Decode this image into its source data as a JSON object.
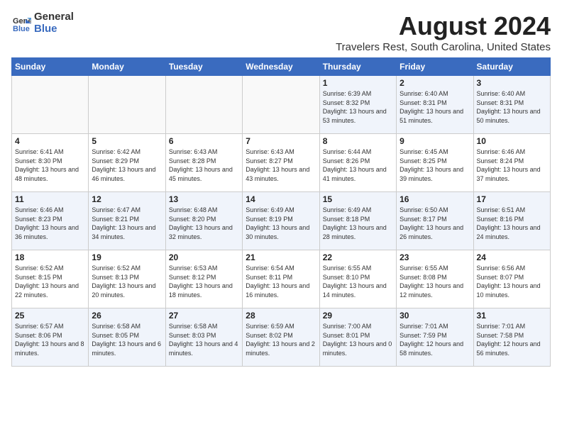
{
  "logo": {
    "general": "General",
    "blue": "Blue"
  },
  "title": "August 2024",
  "subtitle": "Travelers Rest, South Carolina, United States",
  "days_of_week": [
    "Sunday",
    "Monday",
    "Tuesday",
    "Wednesday",
    "Thursday",
    "Friday",
    "Saturday"
  ],
  "weeks": [
    [
      {
        "day": "",
        "detail": ""
      },
      {
        "day": "",
        "detail": ""
      },
      {
        "day": "",
        "detail": ""
      },
      {
        "day": "",
        "detail": ""
      },
      {
        "day": "1",
        "detail": "Sunrise: 6:39 AM\nSunset: 8:32 PM\nDaylight: 13 hours\nand 53 minutes."
      },
      {
        "day": "2",
        "detail": "Sunrise: 6:40 AM\nSunset: 8:31 PM\nDaylight: 13 hours\nand 51 minutes."
      },
      {
        "day": "3",
        "detail": "Sunrise: 6:40 AM\nSunset: 8:31 PM\nDaylight: 13 hours\nand 50 minutes."
      }
    ],
    [
      {
        "day": "4",
        "detail": "Sunrise: 6:41 AM\nSunset: 8:30 PM\nDaylight: 13 hours\nand 48 minutes."
      },
      {
        "day": "5",
        "detail": "Sunrise: 6:42 AM\nSunset: 8:29 PM\nDaylight: 13 hours\nand 46 minutes."
      },
      {
        "day": "6",
        "detail": "Sunrise: 6:43 AM\nSunset: 8:28 PM\nDaylight: 13 hours\nand 45 minutes."
      },
      {
        "day": "7",
        "detail": "Sunrise: 6:43 AM\nSunset: 8:27 PM\nDaylight: 13 hours\nand 43 minutes."
      },
      {
        "day": "8",
        "detail": "Sunrise: 6:44 AM\nSunset: 8:26 PM\nDaylight: 13 hours\nand 41 minutes."
      },
      {
        "day": "9",
        "detail": "Sunrise: 6:45 AM\nSunset: 8:25 PM\nDaylight: 13 hours\nand 39 minutes."
      },
      {
        "day": "10",
        "detail": "Sunrise: 6:46 AM\nSunset: 8:24 PM\nDaylight: 13 hours\nand 37 minutes."
      }
    ],
    [
      {
        "day": "11",
        "detail": "Sunrise: 6:46 AM\nSunset: 8:23 PM\nDaylight: 13 hours\nand 36 minutes."
      },
      {
        "day": "12",
        "detail": "Sunrise: 6:47 AM\nSunset: 8:21 PM\nDaylight: 13 hours\nand 34 minutes."
      },
      {
        "day": "13",
        "detail": "Sunrise: 6:48 AM\nSunset: 8:20 PM\nDaylight: 13 hours\nand 32 minutes."
      },
      {
        "day": "14",
        "detail": "Sunrise: 6:49 AM\nSunset: 8:19 PM\nDaylight: 13 hours\nand 30 minutes."
      },
      {
        "day": "15",
        "detail": "Sunrise: 6:49 AM\nSunset: 8:18 PM\nDaylight: 13 hours\nand 28 minutes."
      },
      {
        "day": "16",
        "detail": "Sunrise: 6:50 AM\nSunset: 8:17 PM\nDaylight: 13 hours\nand 26 minutes."
      },
      {
        "day": "17",
        "detail": "Sunrise: 6:51 AM\nSunset: 8:16 PM\nDaylight: 13 hours\nand 24 minutes."
      }
    ],
    [
      {
        "day": "18",
        "detail": "Sunrise: 6:52 AM\nSunset: 8:15 PM\nDaylight: 13 hours\nand 22 minutes."
      },
      {
        "day": "19",
        "detail": "Sunrise: 6:52 AM\nSunset: 8:13 PM\nDaylight: 13 hours\nand 20 minutes."
      },
      {
        "day": "20",
        "detail": "Sunrise: 6:53 AM\nSunset: 8:12 PM\nDaylight: 13 hours\nand 18 minutes."
      },
      {
        "day": "21",
        "detail": "Sunrise: 6:54 AM\nSunset: 8:11 PM\nDaylight: 13 hours\nand 16 minutes."
      },
      {
        "day": "22",
        "detail": "Sunrise: 6:55 AM\nSunset: 8:10 PM\nDaylight: 13 hours\nand 14 minutes."
      },
      {
        "day": "23",
        "detail": "Sunrise: 6:55 AM\nSunset: 8:08 PM\nDaylight: 13 hours\nand 12 minutes."
      },
      {
        "day": "24",
        "detail": "Sunrise: 6:56 AM\nSunset: 8:07 PM\nDaylight: 13 hours\nand 10 minutes."
      }
    ],
    [
      {
        "day": "25",
        "detail": "Sunrise: 6:57 AM\nSunset: 8:06 PM\nDaylight: 13 hours\nand 8 minutes."
      },
      {
        "day": "26",
        "detail": "Sunrise: 6:58 AM\nSunset: 8:05 PM\nDaylight: 13 hours\nand 6 minutes."
      },
      {
        "day": "27",
        "detail": "Sunrise: 6:58 AM\nSunset: 8:03 PM\nDaylight: 13 hours\nand 4 minutes."
      },
      {
        "day": "28",
        "detail": "Sunrise: 6:59 AM\nSunset: 8:02 PM\nDaylight: 13 hours\nand 2 minutes."
      },
      {
        "day": "29",
        "detail": "Sunrise: 7:00 AM\nSunset: 8:01 PM\nDaylight: 13 hours\nand 0 minutes."
      },
      {
        "day": "30",
        "detail": "Sunrise: 7:01 AM\nSunset: 7:59 PM\nDaylight: 12 hours\nand 58 minutes."
      },
      {
        "day": "31",
        "detail": "Sunrise: 7:01 AM\nSunset: 7:58 PM\nDaylight: 12 hours\nand 56 minutes."
      }
    ]
  ],
  "alt_row_indices": [
    0,
    2,
    4
  ]
}
